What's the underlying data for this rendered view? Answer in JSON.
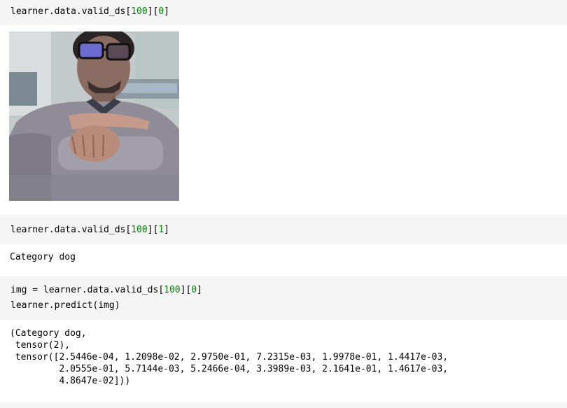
{
  "cells": [
    {
      "input": {
        "line1_prefix": "learner.data.valid_ds[",
        "line1_num1": "100",
        "line1_mid": "][",
        "line1_num2": "0",
        "line1_suffix": "]"
      },
      "output_image": {
        "subject": "person with glasses making hand sign"
      }
    },
    {
      "input": {
        "line1_prefix": "learner.data.valid_ds[",
        "line1_num1": "100",
        "line1_mid": "][",
        "line1_num2": "1",
        "line1_suffix": "]"
      },
      "output_text": "Category dog"
    },
    {
      "input": {
        "line1_prefix": "img = learner.data.valid_ds[",
        "line1_num1": "100",
        "line1_mid": "][",
        "line1_num2": "0",
        "line1_suffix": "]",
        "line2": "learner.predict(img)"
      },
      "output_text": "(Category dog,\n tensor(2),\n tensor([2.5446e-04, 1.2098e-02, 2.9750e-01, 7.2315e-03, 1.9978e-01, 1.4417e-03,\n         2.0555e-01, 5.7144e-03, 5.2466e-04, 3.3989e-03, 2.1641e-01, 1.4617e-03,\n         4.8647e-02]))"
    }
  ]
}
